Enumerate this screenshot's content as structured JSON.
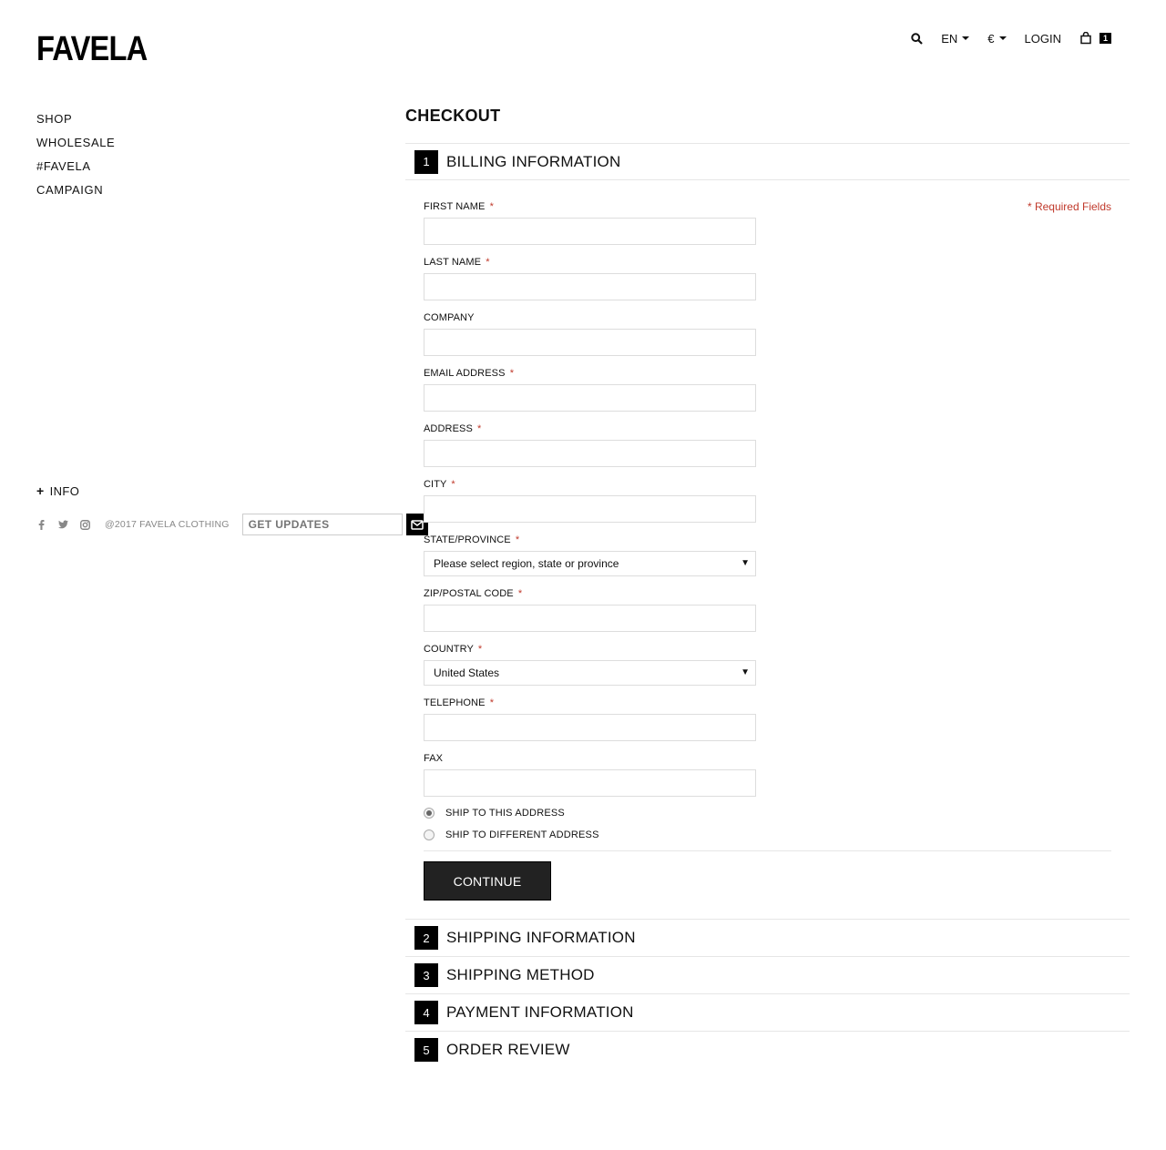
{
  "brand": {
    "logo": "FAVELA"
  },
  "topbar": {
    "language": "EN",
    "currency": "€",
    "login": "LOGIN",
    "cart_count": "1"
  },
  "sidenav": {
    "items": [
      "SHOP",
      "WHOLESALE",
      "#FAVELA",
      "CAMPAIGN"
    ]
  },
  "info": {
    "label": "INFO"
  },
  "footer": {
    "copyright": "@2017 FAVELA CLOTHING",
    "updates_placeholder": "GET UPDATES"
  },
  "checkout": {
    "title": "CHECKOUT",
    "steps": [
      {
        "num": "1",
        "title": "BILLING INFORMATION"
      },
      {
        "num": "2",
        "title": "SHIPPING INFORMATION"
      },
      {
        "num": "3",
        "title": "SHIPPING METHOD"
      },
      {
        "num": "4",
        "title": "PAYMENT INFORMATION"
      },
      {
        "num": "5",
        "title": "ORDER REVIEW"
      }
    ],
    "required_note": "* Required Fields",
    "fields": {
      "first_name": "FIRST NAME",
      "last_name": "LAST NAME",
      "company": "COMPANY",
      "email": "EMAIL ADDRESS",
      "address": "ADDRESS",
      "city": "CITY",
      "state": "STATE/PROVINCE",
      "state_value": "Please select region, state or province",
      "zip": "ZIP/POSTAL CODE",
      "country": "COUNTRY",
      "country_value": "United States",
      "telephone": "TELEPHONE",
      "fax": "FAX"
    },
    "star": "*",
    "ship_same": "SHIP TO THIS ADDRESS",
    "ship_different": "SHIP TO DIFFERENT ADDRESS",
    "continue": "CONTINUE"
  }
}
